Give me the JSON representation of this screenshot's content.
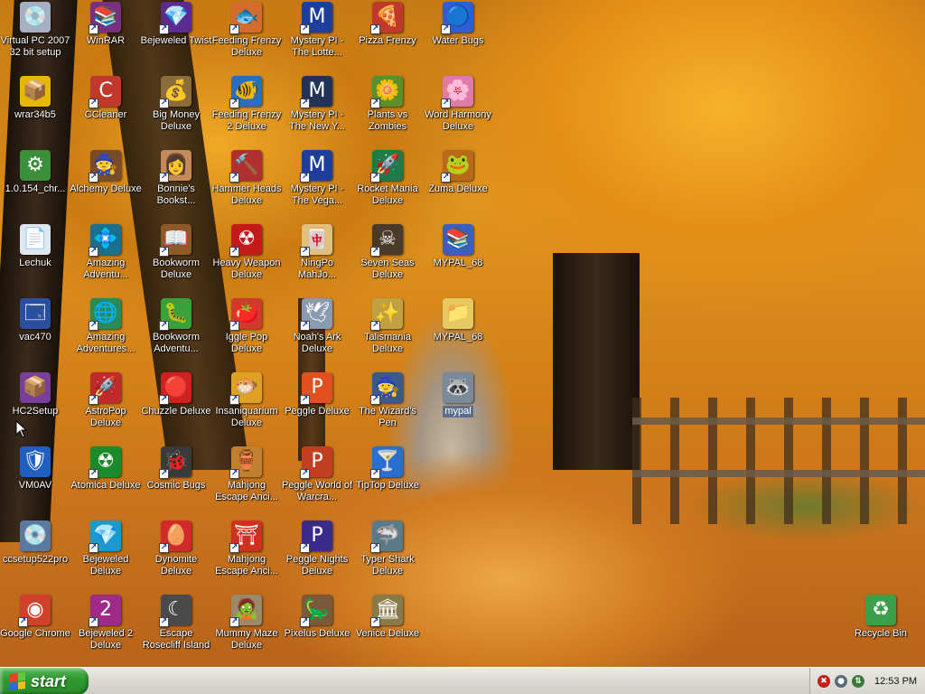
{
  "desktop": {
    "icons": [
      {
        "label": "Virtual PC 2007 32 bit setup",
        "icon": "cd-icon",
        "glyph": "💿",
        "bg": "#a7b0c2",
        "shortcut": false
      },
      {
        "label": "WinRAR",
        "icon": "winrar-icon",
        "glyph": "📚",
        "bg": "#7a2f7f",
        "shortcut": true
      },
      {
        "label": "Bejeweled Twist",
        "icon": "gem-icon",
        "glyph": "💎",
        "bg": "#5b2b92",
        "shortcut": true
      },
      {
        "label": "Feeding Frenzy Deluxe",
        "icon": "fish-icon",
        "glyph": "🐟",
        "bg": "#d46b2b",
        "shortcut": true
      },
      {
        "label": "Mystery PI - The Lotte...",
        "icon": "mystery-pi-icon",
        "glyph": "M",
        "bg": "#1d3e9a",
        "shortcut": true
      },
      {
        "label": "Pizza Frenzy",
        "icon": "pizza-icon",
        "glyph": "🍕",
        "bg": "#c0392b",
        "shortcut": true
      },
      {
        "label": "Water Bugs",
        "icon": "water-bugs-icon",
        "glyph": "🔵",
        "bg": "#2c5fd4",
        "shortcut": true
      },
      {
        "label": "wrar34b5",
        "icon": "installer-icon",
        "glyph": "📦",
        "bg": "#e6b800",
        "shortcut": false
      },
      {
        "label": "CCleaner",
        "icon": "ccleaner-icon",
        "glyph": "C",
        "bg": "#c0392b",
        "shortcut": true
      },
      {
        "label": "Big Money Deluxe",
        "icon": "money-bag-icon",
        "glyph": "💰",
        "bg": "#8a6d3b",
        "shortcut": true
      },
      {
        "label": "Feeding Frenzy 2 Deluxe",
        "icon": "fish-icon",
        "glyph": "🐠",
        "bg": "#2a6fbf",
        "shortcut": true
      },
      {
        "label": "Mystery PI - The New Y...",
        "icon": "mystery-pi-icon",
        "glyph": "M",
        "bg": "#223355",
        "shortcut": true
      },
      {
        "label": "Plants vs Zombies",
        "icon": "flower-icon",
        "glyph": "🌼",
        "bg": "#5a8f2b",
        "shortcut": true
      },
      {
        "label": "Word Harmony Deluxe",
        "icon": "flower-icon",
        "glyph": "🌸",
        "bg": "#e07aa8",
        "shortcut": true
      },
      {
        "label": "1.0.154_chr...",
        "icon": "chrome-installer-icon",
        "glyph": "⚙",
        "bg": "#3a8f3a",
        "shortcut": false
      },
      {
        "label": "Alchemy Deluxe",
        "icon": "alchemy-icon",
        "glyph": "🧙",
        "bg": "#7a4b2a",
        "shortcut": true
      },
      {
        "label": "Bonnie's Bookst...",
        "icon": "bonnie-icon",
        "glyph": "👩",
        "bg": "#c48a5a",
        "shortcut": true
      },
      {
        "label": "Hammer Heads Deluxe",
        "icon": "gnome-icon",
        "glyph": "🔨",
        "bg": "#b03030",
        "shortcut": true
      },
      {
        "label": "Mystery PI - The Vega...",
        "icon": "mystery-pi-icon",
        "glyph": "M",
        "bg": "#1d3e9a",
        "shortcut": true
      },
      {
        "label": "Rocket Mania Deluxe",
        "icon": "rocket-icon",
        "glyph": "🚀",
        "bg": "#1f7a4a",
        "shortcut": true
      },
      {
        "label": "Zuma Deluxe",
        "icon": "zuma-icon",
        "glyph": "🐸",
        "bg": "#b86a1a",
        "shortcut": true
      },
      {
        "label": "Lechuk",
        "icon": "document-icon",
        "glyph": "📄",
        "bg": "#dfe6ee",
        "shortcut": false
      },
      {
        "label": "Amazing Adventu...",
        "icon": "amazing-adventures-icon",
        "glyph": "💠",
        "bg": "#1a6f8f",
        "shortcut": true
      },
      {
        "label": "Bookworm Deluxe",
        "icon": "bookworm-icon",
        "glyph": "📖",
        "bg": "#8f5a2a",
        "shortcut": true
      },
      {
        "label": "Heavy Weapon Deluxe",
        "icon": "radiation-icon",
        "glyph": "☢",
        "bg": "#c41a1a",
        "shortcut": true
      },
      {
        "label": "NingPo MahJo...",
        "icon": "mahjong-tile-icon",
        "glyph": "🀄",
        "bg": "#e0c080",
        "shortcut": true
      },
      {
        "label": "Seven Seas Deluxe",
        "icon": "skull-icon",
        "glyph": "☠",
        "bg": "#4a3a2a",
        "shortcut": true
      },
      {
        "label": "MYPAL_68",
        "icon": "winrar-archive-icon",
        "glyph": "📚",
        "bg": "#3b5fbf",
        "shortcut": false
      },
      {
        "label": "vac470",
        "icon": "program-icon",
        "glyph": "🗔",
        "bg": "#2a4f9f",
        "shortcut": false
      },
      {
        "label": "Amazing Adventures...",
        "icon": "amazing-adventures-icon",
        "glyph": "🌐",
        "bg": "#2a8a5a",
        "shortcut": true
      },
      {
        "label": "Bookworm Adventu...",
        "icon": "bookworm-icon",
        "glyph": "🐛",
        "bg": "#3aa03a",
        "shortcut": true
      },
      {
        "label": "Iggle Pop Deluxe",
        "icon": "iggle-icon",
        "glyph": "🍅",
        "bg": "#d03a2a",
        "shortcut": true
      },
      {
        "label": "Noah's Ark Deluxe",
        "icon": "dove-icon",
        "glyph": "🕊",
        "bg": "#8a9ab0",
        "shortcut": true
      },
      {
        "label": "Talismania Deluxe",
        "icon": "talisman-icon",
        "glyph": "✨",
        "bg": "#c0a040",
        "shortcut": true
      },
      {
        "label": "MYPAL_68",
        "icon": "folder-icon",
        "glyph": "📁",
        "bg": "#e8c860",
        "shortcut": false
      },
      {
        "label": "HC2Setup",
        "icon": "installer-icon",
        "glyph": "📦",
        "bg": "#7a3f9a",
        "shortcut": false
      },
      {
        "label": "AstroPop Deluxe",
        "icon": "astropop-icon",
        "glyph": "🚀",
        "bg": "#c02a2a",
        "shortcut": true
      },
      {
        "label": "Chuzzle Deluxe",
        "icon": "chuzzle-icon",
        "glyph": "🔴",
        "bg": "#d02020",
        "shortcut": true
      },
      {
        "label": "Insaniquarium Deluxe",
        "icon": "fish-icon",
        "glyph": "🐡",
        "bg": "#e0a020",
        "shortcut": true
      },
      {
        "label": "Peggle Deluxe",
        "icon": "peggle-icon",
        "glyph": "P",
        "bg": "#e05020",
        "shortcut": true
      },
      {
        "label": "The Wizard's Pen",
        "icon": "wizard-icon",
        "glyph": "🧙",
        "bg": "#3a5a8a",
        "shortcut": true
      },
      {
        "label": "mypal",
        "icon": "raccoon-icon",
        "glyph": "🦝",
        "bg": "#7a8a9a",
        "shortcut": false,
        "selected": true
      },
      {
        "label": "VM0AV",
        "icon": "shield-icon",
        "glyph": "🛡",
        "bg": "#1f5fbf",
        "shortcut": false
      },
      {
        "label": "Atomica Deluxe",
        "icon": "radiation-icon",
        "glyph": "☢",
        "bg": "#1a8a2a",
        "shortcut": true
      },
      {
        "label": "Cosmic Bugs",
        "icon": "cosmic-bugs-icon",
        "glyph": "🐞",
        "bg": "#3a3a3a",
        "shortcut": true
      },
      {
        "label": "Mahjong Escape Anci...",
        "icon": "mahjong-tile-icon",
        "glyph": "🏺",
        "bg": "#c08030",
        "shortcut": true
      },
      {
        "label": "Peggle World of Warcra...",
        "icon": "peggle-icon",
        "glyph": "P",
        "bg": "#c04020",
        "shortcut": true
      },
      {
        "label": "TipTop Deluxe",
        "icon": "cocktail-icon",
        "glyph": "🍸",
        "bg": "#2a6fd0",
        "shortcut": true
      },
      {
        "label": "ccsetup522pro",
        "icon": "installer-icon",
        "glyph": "💿",
        "bg": "#5a7aa0",
        "shortcut": false
      },
      {
        "label": "Bejeweled Deluxe",
        "icon": "gem-icon",
        "glyph": "💎",
        "bg": "#1a9ad0",
        "shortcut": true
      },
      {
        "label": "Dynomite Deluxe",
        "icon": "dynomite-icon",
        "glyph": "🥚",
        "bg": "#d02a2a",
        "shortcut": true
      },
      {
        "label": "Mahjong Escape Anci...",
        "icon": "mahjong-tile-icon",
        "glyph": "⛩",
        "bg": "#d03020",
        "shortcut": true
      },
      {
        "label": "Peggle Nights Deluxe",
        "icon": "peggle-icon",
        "glyph": "P",
        "bg": "#3a2a8a",
        "shortcut": true
      },
      {
        "label": "Typer Shark Deluxe",
        "icon": "shark-icon",
        "glyph": "🦈",
        "bg": "#5a7a8a",
        "shortcut": true
      },
      {
        "label": "Google Chrome",
        "icon": "chrome-icon",
        "glyph": "◉",
        "bg": "#d0402a",
        "shortcut": true
      },
      {
        "label": "Bejeweled 2 Deluxe",
        "icon": "gem-icon",
        "glyph": "2",
        "bg": "#a02a8a",
        "shortcut": true
      },
      {
        "label": "Escape Rosecliff Island",
        "icon": "moon-icon",
        "glyph": "☾",
        "bg": "#4a4a4a",
        "shortcut": true
      },
      {
        "label": "Mummy Maze Deluxe",
        "icon": "mummy-icon",
        "glyph": "🧟",
        "bg": "#9a8a6a",
        "shortcut": true
      },
      {
        "label": "Pixelus Deluxe",
        "icon": "pixelus-icon",
        "glyph": "🦕",
        "bg": "#7a5a3a",
        "shortcut": true
      },
      {
        "label": "Venice Deluxe",
        "icon": "venice-icon",
        "glyph": "🏛",
        "bg": "#8a7a4a",
        "shortcut": true
      },
      {
        "label": "Recycle Bin",
        "icon": "recycle-bin-icon",
        "glyph": "♻",
        "bg": "#3aa04a",
        "shortcut": false
      }
    ]
  },
  "taskbar": {
    "start_label": "start",
    "clock": "12:53 PM",
    "tray_icons": [
      {
        "icon": "security-alert-icon",
        "glyph": "✖",
        "color": "#c0201a"
      },
      {
        "icon": "shield-tray-icon",
        "glyph": "●",
        "color": "#5a6a7a"
      },
      {
        "icon": "network-tray-icon",
        "glyph": "⇅",
        "color": "#3a7a3a"
      }
    ],
    "start_flag_colors": [
      "#e8402a",
      "#6ac43a",
      "#2a6ae0",
      "#f0c020"
    ]
  }
}
